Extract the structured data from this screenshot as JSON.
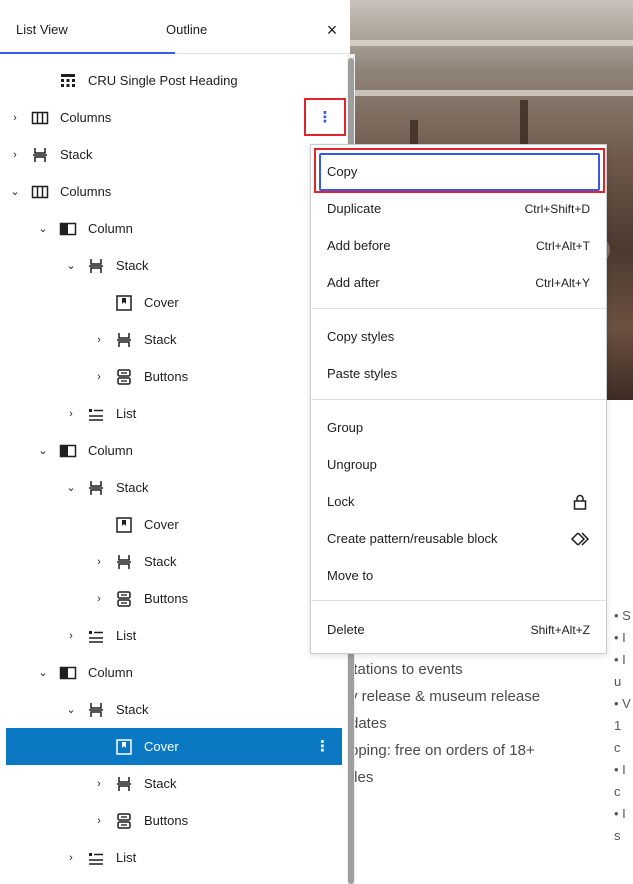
{
  "tabs": {
    "list_view": "List View",
    "outline": "Outline",
    "close": "×"
  },
  "tree": [
    {
      "label": "CRU Single Post Heading",
      "icon": "table-heading-icon",
      "chevron": ""
    },
    {
      "label": "Columns",
      "icon": "columns-icon",
      "chevron": "›"
    },
    {
      "label": "Stack",
      "icon": "stack-icon",
      "chevron": "›"
    },
    {
      "label": "Columns",
      "icon": "columns-icon",
      "chevron": "⌄"
    },
    {
      "label": "Column",
      "icon": "column-icon",
      "chevron": "⌄"
    },
    {
      "label": "Stack",
      "icon": "stack-icon",
      "chevron": "⌄"
    },
    {
      "label": "Cover",
      "icon": "cover-icon",
      "chevron": ""
    },
    {
      "label": "Stack",
      "icon": "stack-icon",
      "chevron": "›"
    },
    {
      "label": "Buttons",
      "icon": "buttons-icon",
      "chevron": "›"
    },
    {
      "label": "List",
      "icon": "list-icon",
      "chevron": "›"
    },
    {
      "label": "Column",
      "icon": "column-icon",
      "chevron": "⌄"
    },
    {
      "label": "Stack",
      "icon": "stack-icon",
      "chevron": "⌄"
    },
    {
      "label": "Cover",
      "icon": "cover-icon",
      "chevron": ""
    },
    {
      "label": "Stack",
      "icon": "stack-icon",
      "chevron": "›"
    },
    {
      "label": "Buttons",
      "icon": "buttons-icon",
      "chevron": "›"
    },
    {
      "label": "List",
      "icon": "list-icon",
      "chevron": "›"
    },
    {
      "label": "Column",
      "icon": "column-icon",
      "chevron": "⌄"
    },
    {
      "label": "Stack",
      "icon": "stack-icon",
      "chevron": "⌄"
    },
    {
      "label": "Cover",
      "icon": "cover-icon",
      "chevron": "",
      "selected": true
    },
    {
      "label": "Stack",
      "icon": "stack-icon",
      "chevron": "›"
    },
    {
      "label": "Buttons",
      "icon": "buttons-icon",
      "chevron": "›"
    },
    {
      "label": "List",
      "icon": "list-icon",
      "chevron": "›"
    }
  ],
  "options_glyph": "⋮",
  "menu": {
    "copy": "Copy",
    "duplicate": {
      "label": "Duplicate",
      "shortcut": "Ctrl+Shift+D"
    },
    "add_before": {
      "label": "Add before",
      "shortcut": "Ctrl+Alt+T"
    },
    "add_after": {
      "label": "Add after",
      "shortcut": "Ctrl+Alt+Y"
    },
    "copy_styles": "Copy styles",
    "paste_styles": "Paste styles",
    "group": "Group",
    "ungroup": "Ungroup",
    "lock": "Lock",
    "create_pattern": "Create pattern/reusable block",
    "move_to": "Move to",
    "delete": {
      "label": "Delete",
      "shortcut": "Shift+Alt+Z"
    }
  },
  "canvas_lines": [
    "itations to events",
    "v release & museum release",
    "dates",
    "pping: free on orders of 18+",
    "tles"
  ],
  "right_bullets": [
    "• S",
    "• I",
    "• I",
    "  u",
    "• V",
    "  1",
    "  c",
    "• I",
    "  c",
    "• I",
    "  s"
  ],
  "colors": {
    "accent": "#3858e9",
    "selected_row": "#0a78c2",
    "highlight": "#e0242d"
  }
}
